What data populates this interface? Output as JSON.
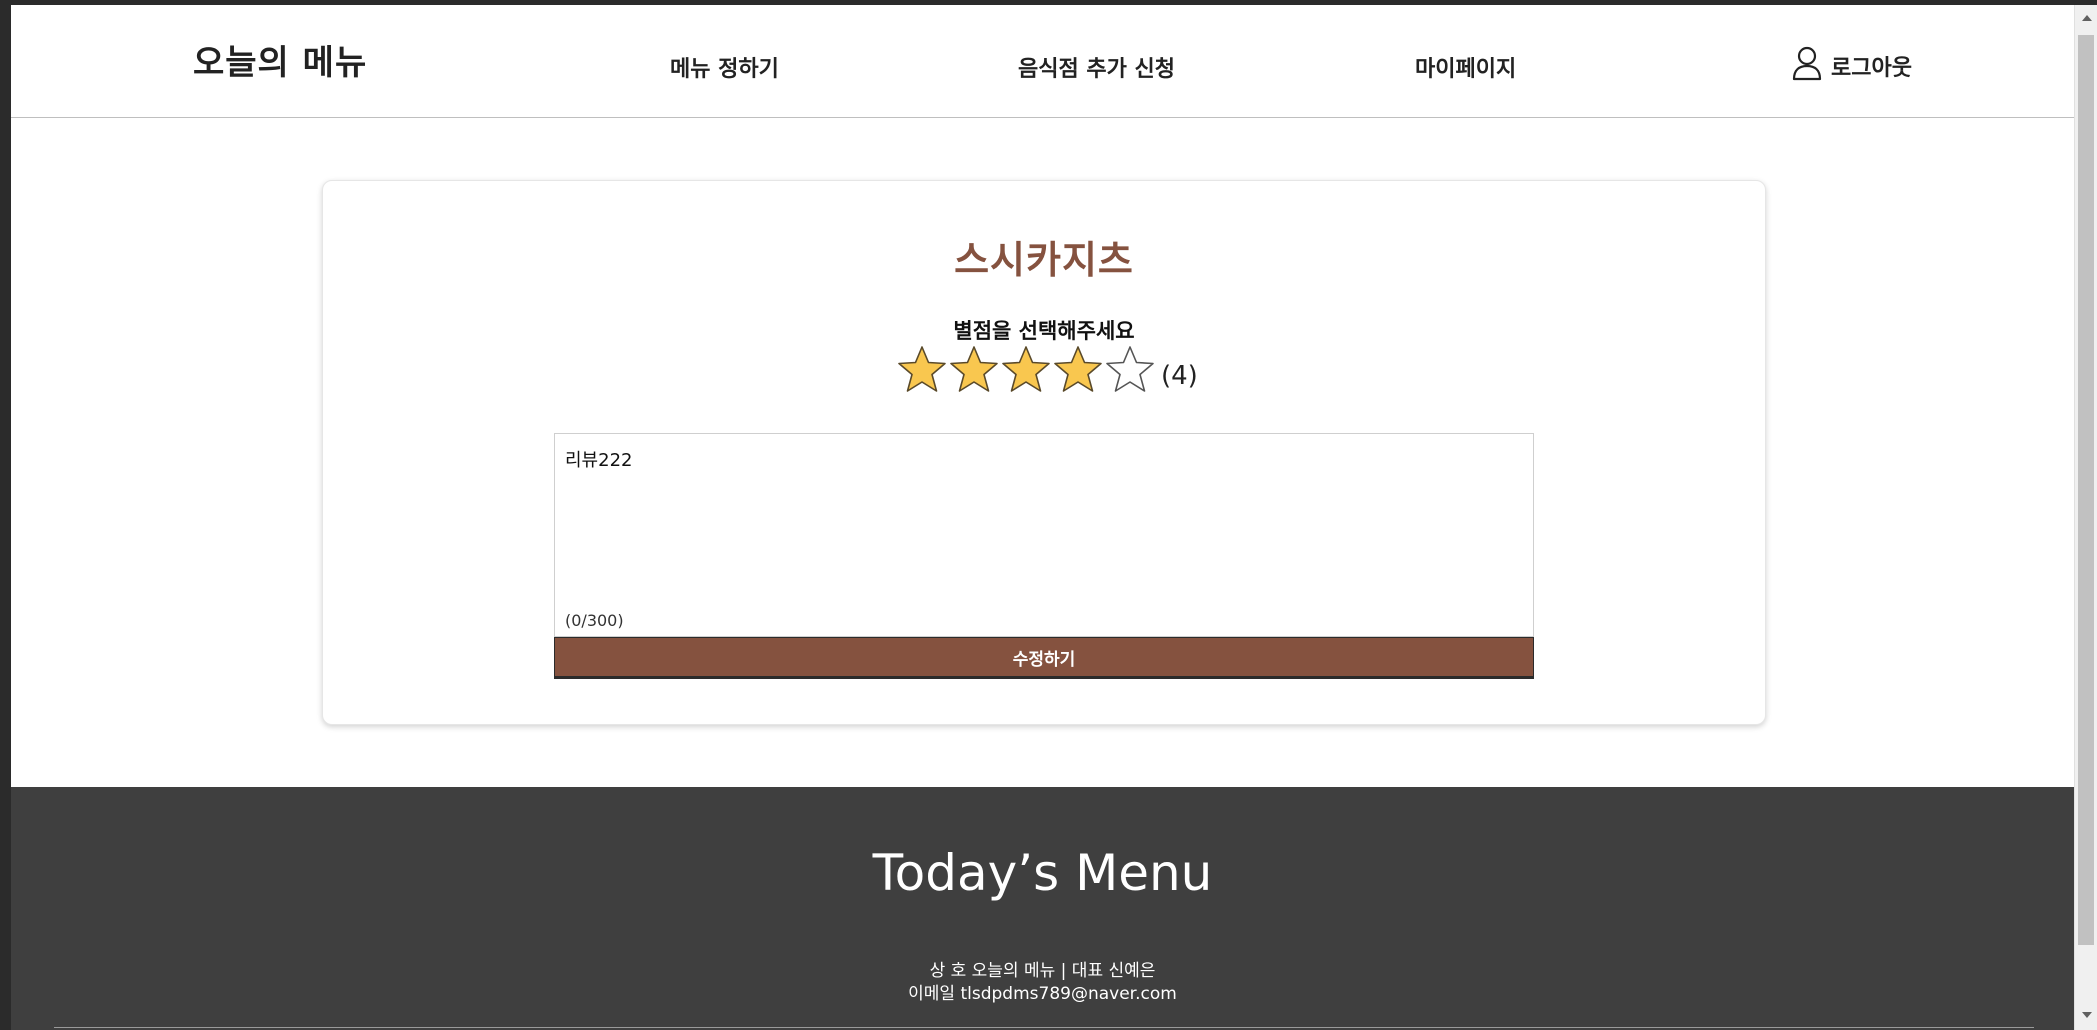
{
  "header": {
    "logo": "오늘의 메뉴",
    "nav": [
      {
        "label": "메뉴 정하기"
      },
      {
        "label": "음식점 추가 신청"
      },
      {
        "label": "마이페이지"
      }
    ],
    "logout_label": "로그아웃"
  },
  "review_form": {
    "shop_name": "스시카지츠",
    "rating_prompt": "별점을 선택해주세요",
    "rating_value": 4,
    "rating_max": 5,
    "rating_count_text": "(4)",
    "review_text": "리뷰222",
    "char_count": "(0/300)",
    "submit_label": "수정하기"
  },
  "footer": {
    "title": "Today’s Menu",
    "line1": "상 호 오늘의 메뉴 | 대표 신예은",
    "line2": "이메일 tlsdpdms789@naver.com"
  },
  "colors": {
    "accent": "#85523f",
    "star_filled": "#f9c74f",
    "footer_bg": "#3f3f3f"
  },
  "icons": {
    "user": "user-icon",
    "star": "star-icon"
  }
}
